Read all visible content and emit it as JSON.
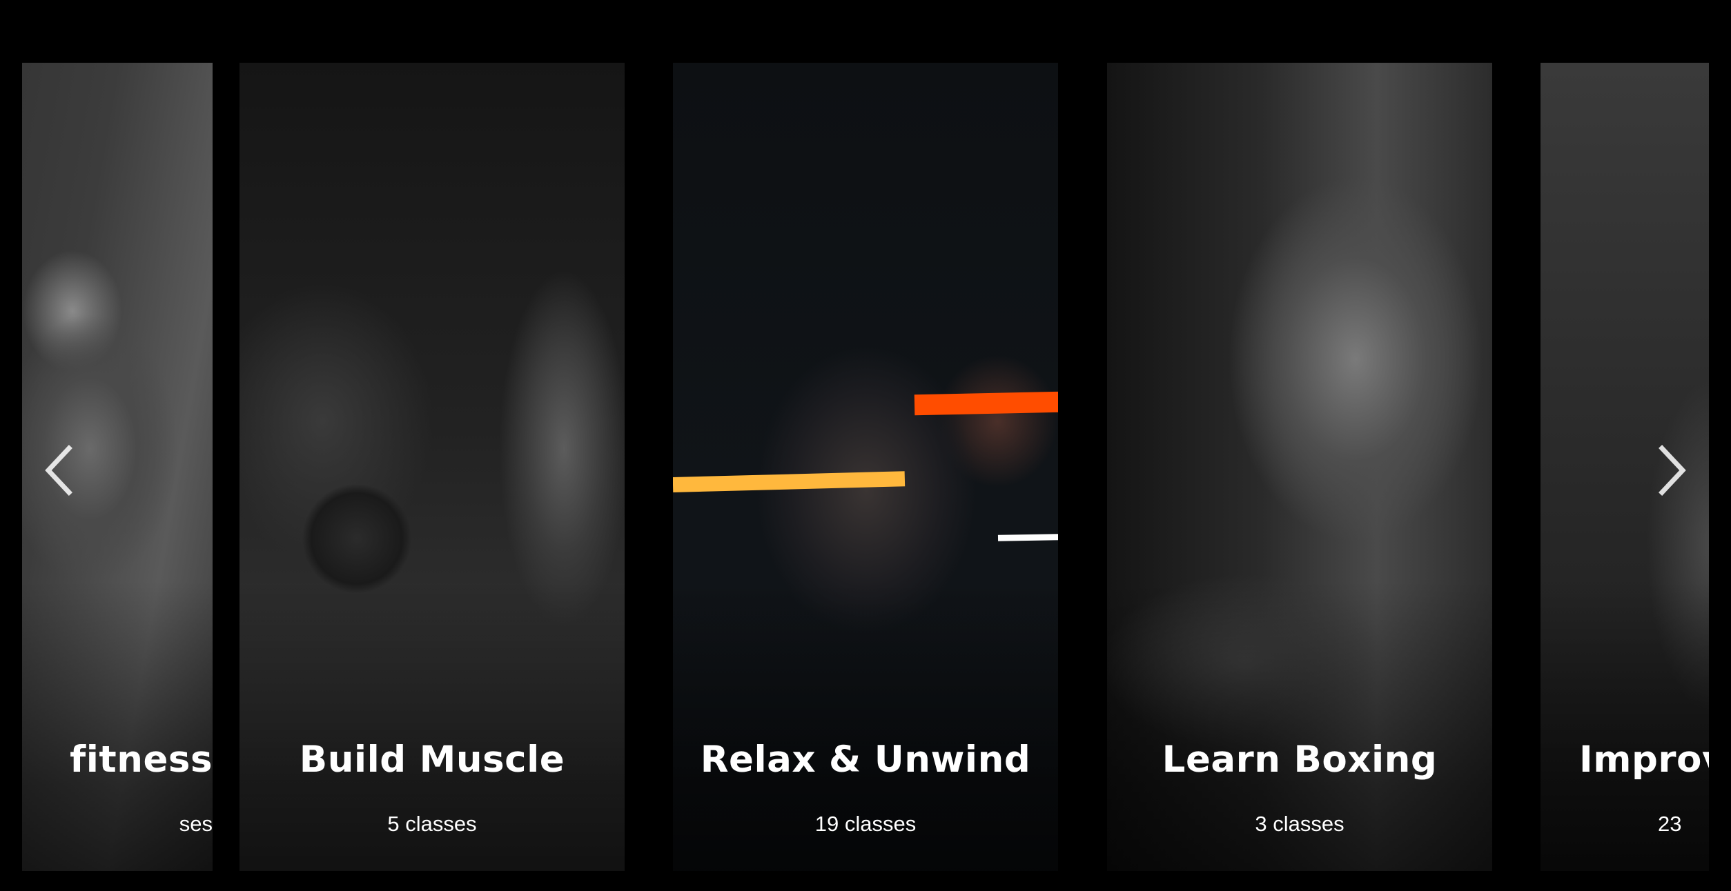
{
  "carousel": {
    "cards": [
      {
        "title": "fitness",
        "count": "ses",
        "image": "man-with-battle-ropes"
      },
      {
        "title": "Build Muscle",
        "count": "5 classes",
        "image": "man-lifting-barbell"
      },
      {
        "title": "Relax & Unwind",
        "count": "19 classes",
        "image": "woman-on-leg-press"
      },
      {
        "title": "Learn Boxing",
        "count": "3 classes",
        "image": "woman-boxing-hair-flying"
      },
      {
        "title": "Improv",
        "count": "23",
        "image": "gym-interior"
      }
    ],
    "nav": {
      "prev_icon": "chevron-left-icon",
      "next_icon": "chevron-right-icon"
    },
    "accent_colors": {
      "orange": "#ff4d00",
      "yellow": "#ffb83d",
      "white": "#ffffff"
    }
  }
}
